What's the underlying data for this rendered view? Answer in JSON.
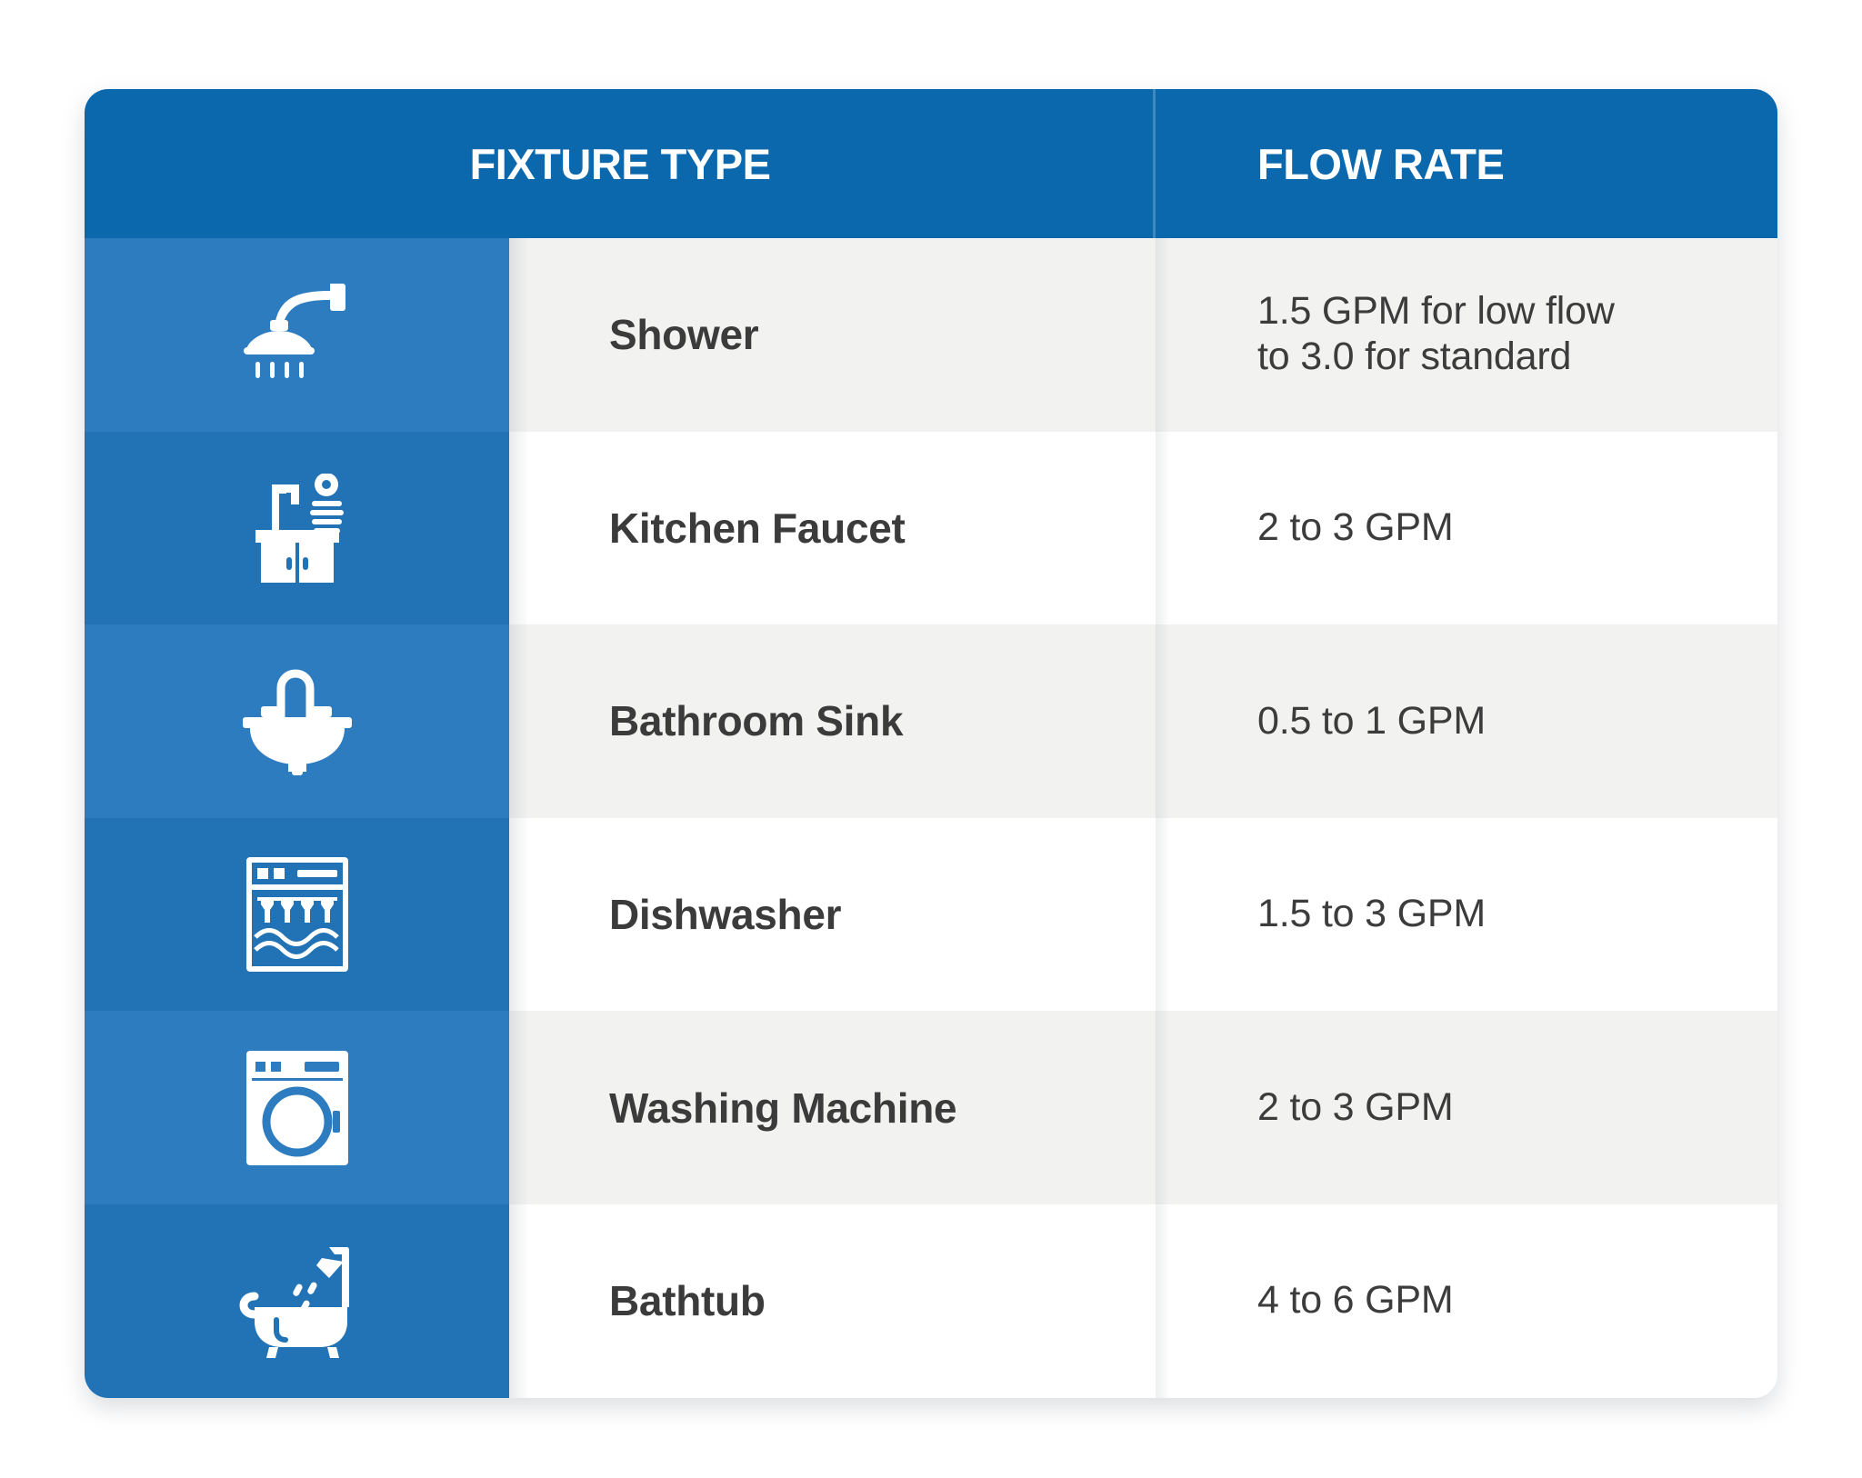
{
  "table": {
    "columns": [
      {
        "key": "fixture",
        "label": "FIXTURE TYPE"
      },
      {
        "key": "flow",
        "label": "FLOW RATE"
      }
    ],
    "rows": [
      {
        "icon": "shower-head-icon",
        "fixture": "Shower",
        "flow": "1.5 GPM for low flow\nto 3.0 for standard"
      },
      {
        "icon": "kitchen-faucet-icon",
        "fixture": "Kitchen Faucet",
        "flow": "2 to 3 GPM"
      },
      {
        "icon": "bathroom-sink-icon",
        "fixture": "Bathroom Sink",
        "flow": "0.5 to 1 GPM"
      },
      {
        "icon": "dishwasher-icon",
        "fixture": "Dishwasher",
        "flow": "1.5 to 3 GPM"
      },
      {
        "icon": "washing-machine-icon",
        "fixture": "Washing Machine",
        "flow": "2 to 3 GPM"
      },
      {
        "icon": "bathtub-icon",
        "fixture": "Bathtub",
        "flow": "4 to 6 GPM"
      }
    ]
  },
  "colors": {
    "header_blue": "#0b68ad",
    "icon_column_light": "#2d7cc0",
    "icon_column_dark": "#2273b6",
    "row_gray": "#f2f2f1",
    "row_white": "#ffffff",
    "text_dark": "#3b3b3b",
    "icon_white": "#ffffff"
  }
}
